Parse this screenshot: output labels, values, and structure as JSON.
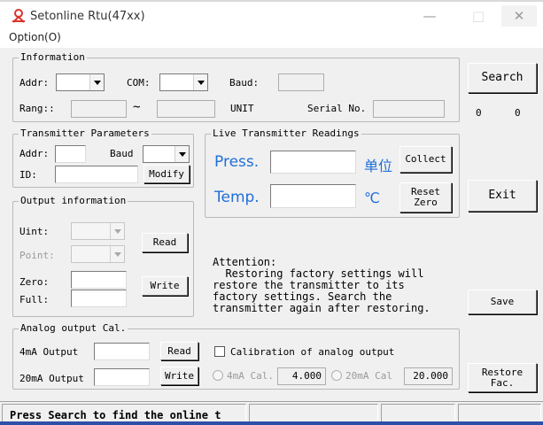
{
  "window": {
    "title": "Setonline Rtu(47xx)",
    "minimize": "—",
    "maximize": "□",
    "close": "✕"
  },
  "menu": {
    "option": "Option(O)"
  },
  "information": {
    "legend": "Information",
    "addr_label": "Addr:",
    "com_label": "COM:",
    "baud_label": "Baud:",
    "rang_label": "Rang::",
    "tilde": "~",
    "unit_label": "UNIT",
    "serial_label": "Serial No."
  },
  "search": {
    "button": "Search",
    "count_left": "0",
    "count_right": "0"
  },
  "transmitter_params": {
    "legend": "Transmitter Parameters",
    "addr_label": "Addr:",
    "baud_label": "Baud",
    "id_label": "ID:",
    "modify_button": "Modify"
  },
  "live": {
    "legend": "Live Transmitter Readings",
    "press_label": "Press.",
    "press_unit": "单位",
    "collect_button": "Collect",
    "temp_label": "Temp.",
    "temp_unit": "℃",
    "reset_zero_button": "Reset\nZero"
  },
  "exit_button": "Exit",
  "output": {
    "legend": "Output information",
    "uint_label": "Uint:",
    "point_label": "Point:",
    "zero_label": "Zero:",
    "full_label": "Full:",
    "read_button": "Read",
    "write_button": "Write"
  },
  "attention": {
    "text": "Attention:\n  Restoring factory settings will\nrestore the transmitter to its\nfactory settings. Search the\ntransmitter again after restoring."
  },
  "save_button": "Save",
  "analog": {
    "legend": "Analog output Cal.",
    "out4_label": "4mA Output",
    "out20_label": "20mA Output",
    "read_button": "Read",
    "write_button": "Write",
    "cal_checkbox_label": "Calibration of analog output",
    "cal4_label": "4mA Cal.",
    "cal4_value": "4.000",
    "cal20_label": "20mA Cal",
    "cal20_value": "20.000"
  },
  "restore_button": "Restore\nFac.",
  "status": {
    "text": "Press Search to find the online t"
  },
  "colors": {
    "accent_blue": "#1f6fd8",
    "icon_red": "#d9332b"
  }
}
